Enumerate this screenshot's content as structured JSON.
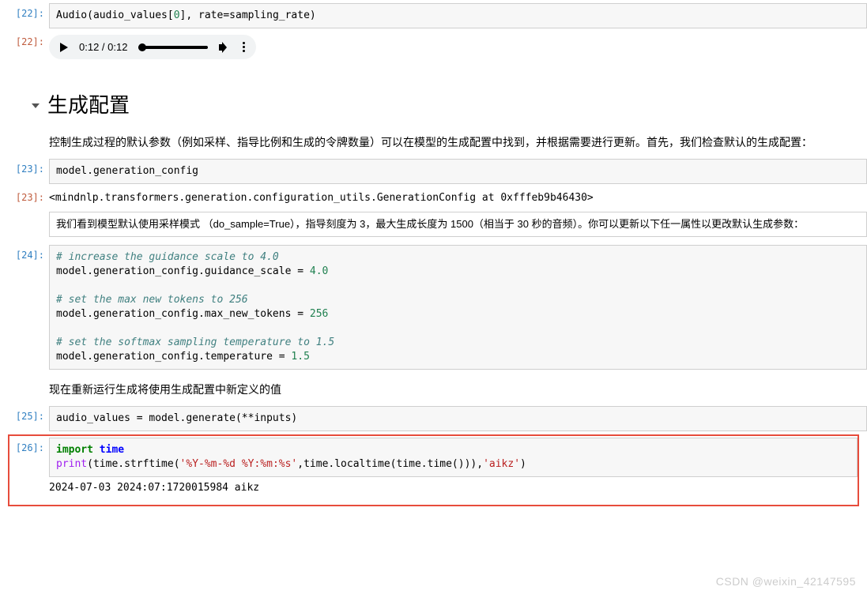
{
  "cell0": {
    "prompt": "[22]:",
    "code_html": "Audio(audio_values[<span class='c-num'>0</span>], rate=sampling_rate)"
  },
  "cell0out_prompt": "[22]:",
  "audio": {
    "time": "0:12 / 0:12"
  },
  "md_heading": "生成配置",
  "md_para1": "控制生成过程的默认参数（例如采样、指导比例和生成的令牌数量）可以在模型的生成配置中找到，并根据需要进行更新。首先，我们检查默认的生成配置：",
  "cell1": {
    "prompt": "[23]:",
    "code_html": "model.generation_config"
  },
  "cell1out": {
    "prompt": "[23]:",
    "text": "<mindnlp.transformers.generation.configuration_utils.GenerationConfig at 0xfffeb9b46430>"
  },
  "md_box2": "我们看到模型默认使用采样模式 （do_sample=True），指导刻度为 3，最大生成长度为 1500（相当于 30 秒的音频）。你可以更新以下任一属性以更改默认生成参数：",
  "cell2": {
    "prompt": "[24]:",
    "code_html": "<span class='c-cmt'># increase the guidance scale to 4.0</span>\nmodel.generation_config.guidance_scale = <span class='c-num'>4.0</span>\n\n<span class='c-cmt'># set the max new tokens to 256</span>\nmodel.generation_config.max_new_tokens = <span class='c-num'>256</span>\n\n<span class='c-cmt'># set the softmax sampling temperature to 1.5</span>\nmodel.generation_config.temperature = <span class='c-num'>1.5</span>"
  },
  "md_para3": "现在重新运行生成将使用生成配置中新定义的值",
  "cell3": {
    "prompt": "[25]:",
    "code_html": "audio_values = model.generate(**inputs)"
  },
  "cell4": {
    "prompt": "[26]:",
    "code_html": "<span class='c-kw'>import</span> <span class='c-mod'>time</span>\n<span class='c-purple'>print</span>(time.strftime(<span class='c-str'>'%Y-%m-%d %Y:%m:%s'</span>,time.localtime(time.time())),<span class='c-str'>'aikz'</span>)",
    "out": "2024-07-03 2024:07:1720015984 aikz"
  },
  "watermark": "CSDN @weixin_42147595"
}
